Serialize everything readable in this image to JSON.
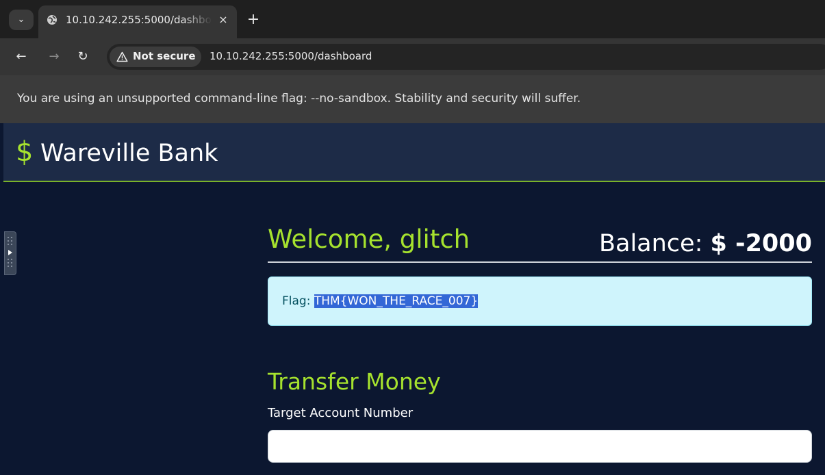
{
  "browser": {
    "tab": {
      "title": "10.10.242.255:5000/dashboard",
      "close_glyph": "×"
    },
    "new_tab_glyph": "+",
    "tab_menu_glyph": "⌄",
    "nav": {
      "back_glyph": "←",
      "forward_glyph": "→",
      "reload_glyph": "↻"
    },
    "security_label": "Not secure",
    "url": "10.10.242.255:5000/dashboard",
    "infobar_text": "You are using an unsupported command-line flag: --no-sandbox. Stability and security will suffer."
  },
  "site": {
    "brand_symbol": "$",
    "brand_name": "Wareville Bank"
  },
  "dashboard": {
    "welcome": "Welcome, glitch",
    "balance_label": "Balance:",
    "balance_value": "$ -2000",
    "flag_label": "Flag:",
    "flag_value": "THM{WON_THE_RACE_007}"
  },
  "transfer": {
    "title": "Transfer Money",
    "target_label": "Target Account Number",
    "target_value": ""
  },
  "colors": {
    "accent_green": "#a6e22e",
    "page_bg": "#0c1730",
    "navbar_bg": "#1d2b47",
    "flag_bg": "#cff4fc"
  },
  "icons": [
    "chevron-down-icon",
    "globe-icon",
    "close-icon",
    "plus-icon",
    "back-arrow-icon",
    "forward-arrow-icon",
    "reload-icon",
    "warning-icon",
    "sidebar-toggle-icon"
  ]
}
